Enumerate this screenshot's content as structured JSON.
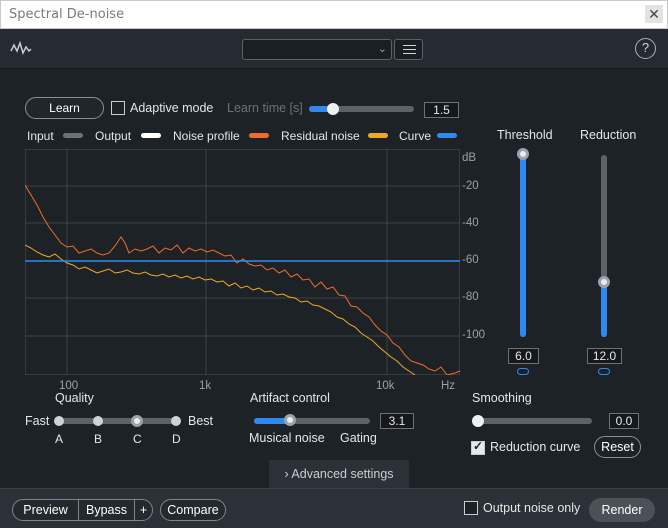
{
  "window": {
    "title": "Spectral De-noise",
    "close_glyph": "✕"
  },
  "topbar": {
    "preset_value": "",
    "help_glyph": "?"
  },
  "learn": {
    "button_label": "Learn",
    "adaptive_label": "Adaptive mode",
    "adaptive_checked": false,
    "learn_time_label": "Learn time [s]",
    "learn_time_value": "1.5",
    "learn_time_level": 0.24
  },
  "legend": [
    {
      "label": "Input",
      "color": "#6a7178"
    },
    {
      "label": "Output",
      "color": "#ffffff"
    },
    {
      "label": "Noise profile",
      "color": "#f26b2a"
    },
    {
      "label": "Residual noise",
      "color": "#f2a72a"
    },
    {
      "label": "Curve",
      "color": "#2f89ee"
    }
  ],
  "chart_data": {
    "type": "line",
    "ylabel": "dB",
    "xlabel": "Hz",
    "y_ticks": [
      "-20",
      "-40",
      "-60",
      "-80",
      "-100"
    ],
    "x_ticks": [
      "100",
      "1k",
      "10k"
    ],
    "curve_level_db": -60
  },
  "threshold": {
    "label": "Threshold",
    "value": "6.0",
    "level": 1.0
  },
  "reduction": {
    "label": "Reduction",
    "value": "12.0",
    "level": 0.3
  },
  "quality": {
    "label": "Quality",
    "left": "Fast",
    "right": "Best",
    "steps": [
      "A",
      "B",
      "C",
      "D"
    ],
    "selected": "C"
  },
  "artifact": {
    "label": "Artifact control",
    "value": "3.1",
    "left": "Musical noise",
    "right": "Gating",
    "level": 0.3
  },
  "smoothing": {
    "label": "Smoothing",
    "value": "0.0",
    "level": 0.0
  },
  "reduction_curve": {
    "label": "Reduction curve",
    "checked": true
  },
  "reset_label": "Reset",
  "advanced_label": "Advanced settings",
  "advanced_glyph": "›",
  "bottom": {
    "preview": "Preview",
    "bypass": "Bypass",
    "plus": "+",
    "compare": "Compare",
    "output_noise_label": "Output noise only",
    "output_noise_checked": false,
    "render": "Render"
  }
}
